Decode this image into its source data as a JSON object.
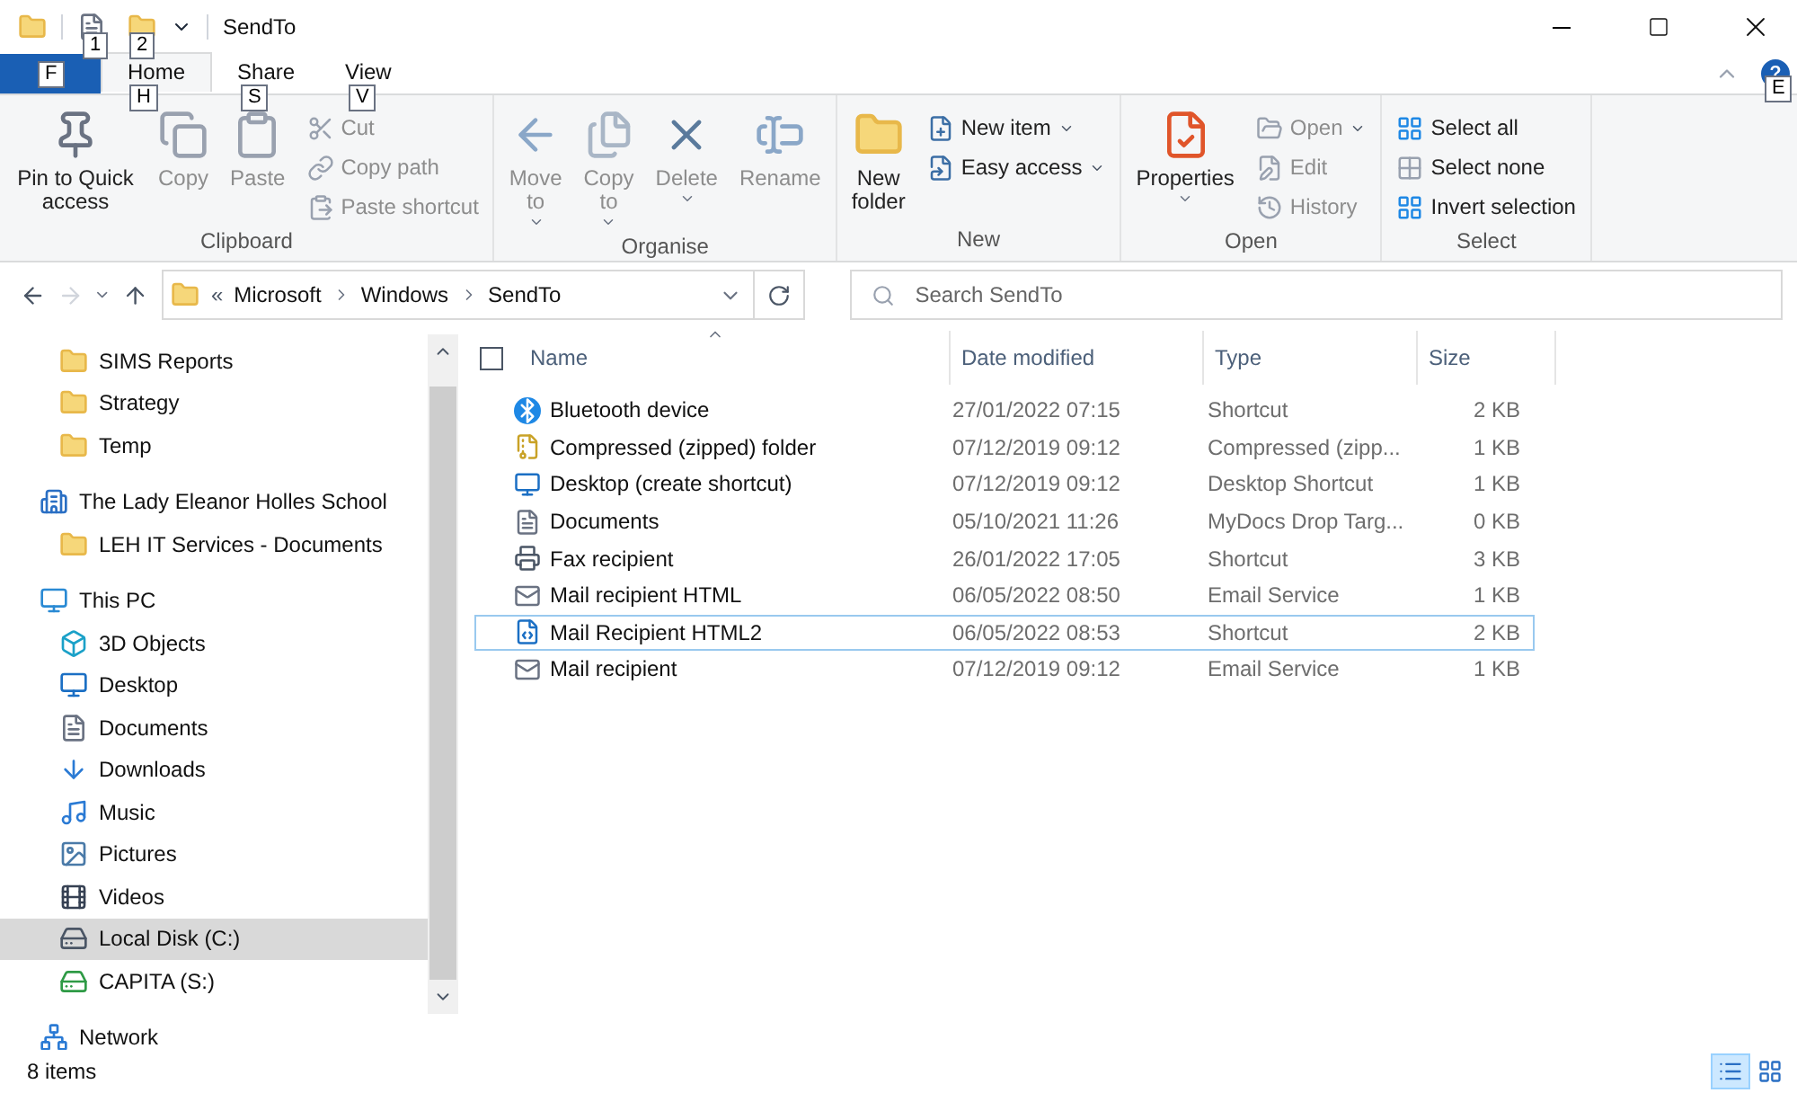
{
  "window": {
    "title": "SendTo",
    "quick_access_keytips": [
      "1",
      "2"
    ]
  },
  "ribbon": {
    "tabs": [
      {
        "kind": "file",
        "keytip": "F",
        "selected": false
      },
      {
        "kind": "tab",
        "label": "Home",
        "keytip": "H",
        "selected": true
      },
      {
        "kind": "tab",
        "label": "Share",
        "keytip": "S",
        "selected": false
      },
      {
        "kind": "tab",
        "label": "View",
        "keytip": "V",
        "selected": false
      }
    ],
    "help_keytip": "E",
    "groups": [
      {
        "label": "Clipboard",
        "large": [
          {
            "label": "Pin to Quick access",
            "disabled": false,
            "dropdown": false
          },
          {
            "label": "Copy",
            "disabled": true,
            "dropdown": false
          },
          {
            "label": "Paste",
            "disabled": true,
            "dropdown": false
          }
        ],
        "small": [
          {
            "label": "Cut",
            "disabled": true,
            "dropdown": false
          },
          {
            "label": "Copy path",
            "disabled": true,
            "dropdown": false
          },
          {
            "label": "Paste shortcut",
            "disabled": true,
            "dropdown": false
          }
        ]
      },
      {
        "label": "Organise",
        "large": [
          {
            "label": "Move to",
            "disabled": true,
            "dropdown": true
          },
          {
            "label": "Copy to",
            "disabled": true,
            "dropdown": true
          },
          {
            "label": "Delete",
            "disabled": true,
            "dropdown": true
          },
          {
            "label": "Rename",
            "disabled": true,
            "dropdown": false
          }
        ]
      },
      {
        "label": "New",
        "large": [
          {
            "label": "New folder",
            "disabled": false,
            "dropdown": false
          }
        ],
        "small": [
          {
            "label": "New item",
            "disabled": false,
            "dropdown": true
          },
          {
            "label": "Easy access",
            "disabled": false,
            "dropdown": true
          }
        ]
      },
      {
        "label": "Open",
        "large": [
          {
            "label": "Properties",
            "disabled": false,
            "dropdown": true
          }
        ],
        "small": [
          {
            "label": "Open",
            "disabled": true,
            "dropdown": true
          },
          {
            "label": "Edit",
            "disabled": true,
            "dropdown": false
          },
          {
            "label": "History",
            "disabled": true,
            "dropdown": false
          }
        ]
      },
      {
        "label": "Select",
        "small": [
          {
            "label": "Select all",
            "disabled": false,
            "dropdown": false
          },
          {
            "label": "Select none",
            "disabled": false,
            "dropdown": false
          },
          {
            "label": "Invert selection",
            "disabled": false,
            "dropdown": false
          }
        ]
      }
    ]
  },
  "address": {
    "overflow": "«",
    "crumbs": [
      "Microsoft",
      "Windows",
      "SendTo"
    ],
    "forward_disabled": true,
    "search_placeholder": "Search SendTo"
  },
  "navigation": [
    {
      "children": [
        {
          "label": "SIMS Reports",
          "selected": false
        },
        {
          "label": "Strategy",
          "selected": false
        },
        {
          "label": "Temp",
          "selected": false
        }
      ]
    },
    {
      "label": "The Lady Eleanor Holles School",
      "selected": false,
      "children": [
        {
          "label": "LEH IT Services - Documents",
          "selected": false
        }
      ]
    },
    {
      "label": "This PC",
      "selected": false,
      "children": [
        {
          "label": "3D Objects",
          "selected": false
        },
        {
          "label": "Desktop",
          "selected": false
        },
        {
          "label": "Documents",
          "selected": false
        },
        {
          "label": "Downloads",
          "selected": false
        },
        {
          "label": "Music",
          "selected": false
        },
        {
          "label": "Pictures",
          "selected": false
        },
        {
          "label": "Videos",
          "selected": false
        },
        {
          "label": "Local Disk (C:)",
          "selected": true
        },
        {
          "label": "CAPITA (S:)",
          "selected": false
        }
      ]
    },
    {
      "label": "Network",
      "selected": false
    }
  ],
  "files": {
    "columns": [
      "Name",
      "Date modified",
      "Type",
      "Size"
    ],
    "select_all_checked": false,
    "rows": [
      {
        "name": "Bluetooth device",
        "date": "27/01/2022 07:15",
        "type": "Shortcut",
        "size": "2 KB",
        "focused": false
      },
      {
        "name": "Compressed (zipped) folder",
        "date": "07/12/2019 09:12",
        "type": "Compressed (zipp...",
        "size": "1 KB",
        "focused": false
      },
      {
        "name": "Desktop (create shortcut)",
        "date": "07/12/2019 09:12",
        "type": "Desktop Shortcut",
        "size": "1 KB",
        "focused": false
      },
      {
        "name": "Documents",
        "date": "05/10/2021 11:26",
        "type": "MyDocs Drop Targ...",
        "size": "0 KB",
        "focused": false
      },
      {
        "name": "Fax recipient",
        "date": "26/01/2022 17:05",
        "type": "Shortcut",
        "size": "3 KB",
        "focused": false
      },
      {
        "name": "Mail recipient HTML",
        "date": "06/05/2022 08:50",
        "type": "Email Service",
        "size": "1 KB",
        "focused": false
      },
      {
        "name": "Mail Recipient HTML2",
        "date": "06/05/2022 08:53",
        "type": "Shortcut",
        "size": "2 KB",
        "focused": true
      },
      {
        "name": "Mail recipient",
        "date": "07/12/2019 09:12",
        "type": "Email Service",
        "size": "1 KB",
        "focused": false
      }
    ]
  },
  "status_bar": {
    "item_count": "8 items",
    "views": [
      {
        "selected": true
      },
      {
        "selected": false
      }
    ]
  }
}
